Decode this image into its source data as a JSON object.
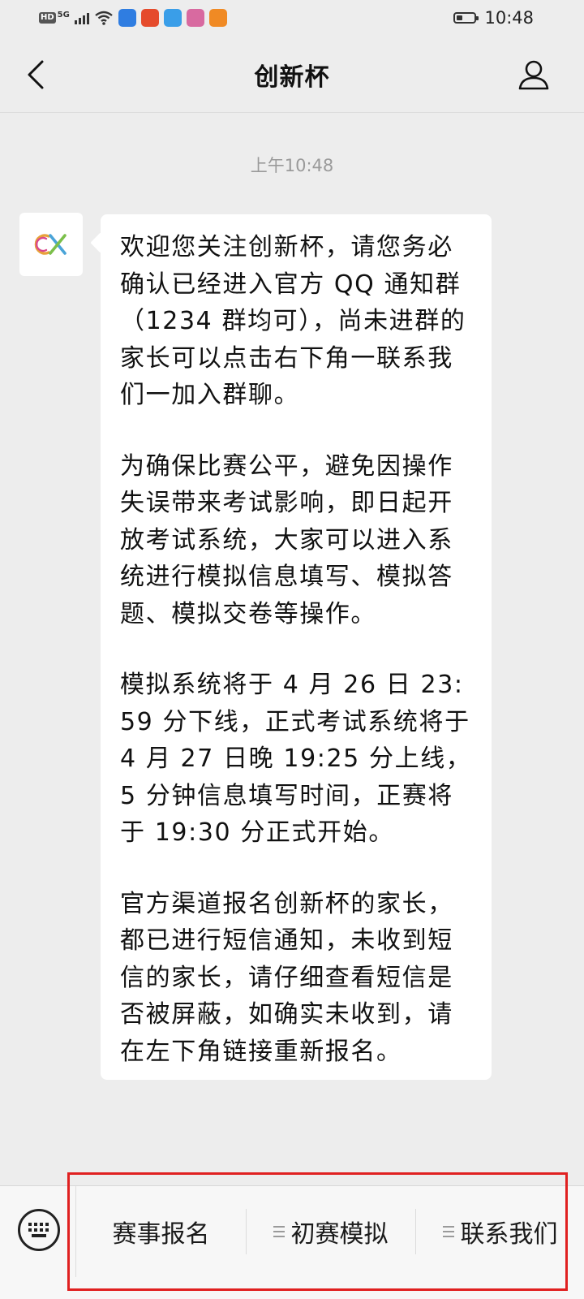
{
  "status_bar": {
    "network_badge": "HD",
    "network_type": "5G",
    "time": "10:48",
    "battery_level": 0.35,
    "app_icon_colors": [
      "#2f7de1",
      "#e54b2c",
      "#3a9ee8",
      "#d86aa0",
      "#f08a24"
    ]
  },
  "nav": {
    "title": "创新杯"
  },
  "chat": {
    "timestamp": "上午10:48",
    "message_paragraphs": [
      "欢迎您关注创新杯，请您务必确认已经进入官方 QQ 通知群（1234 群均可），尚未进群的家长可以点击右下角一联系我们一加入群聊。",
      "为确保比赛公平，避免因操作失误带来考试影响，即日起开放考试系统，大家可以进入系统进行模拟信息填写、模拟答题、模拟交卷等操作。",
      "模拟系统将于 4 月 26 日 23:59 分下线，正式考试系统将于 4 月 27 日晚 19:25 分上线，5 分钟信息填写时间，正赛将于 19:30 分正式开始。",
      "官方渠道报名创新杯的家长，都已进行短信通知，未收到短信的家长，请仔细查看短信是否被屏蔽，如确实未收到，请在左下角链接重新报名。"
    ]
  },
  "menu": {
    "items": [
      {
        "label": "赛事报名",
        "has_submenu": false
      },
      {
        "label": "初赛模拟",
        "has_submenu": true
      },
      {
        "label": "联系我们",
        "has_submenu": true
      }
    ]
  },
  "colors": {
    "background": "#ededed",
    "bubble": "#ffffff",
    "highlight": "#e02020"
  }
}
